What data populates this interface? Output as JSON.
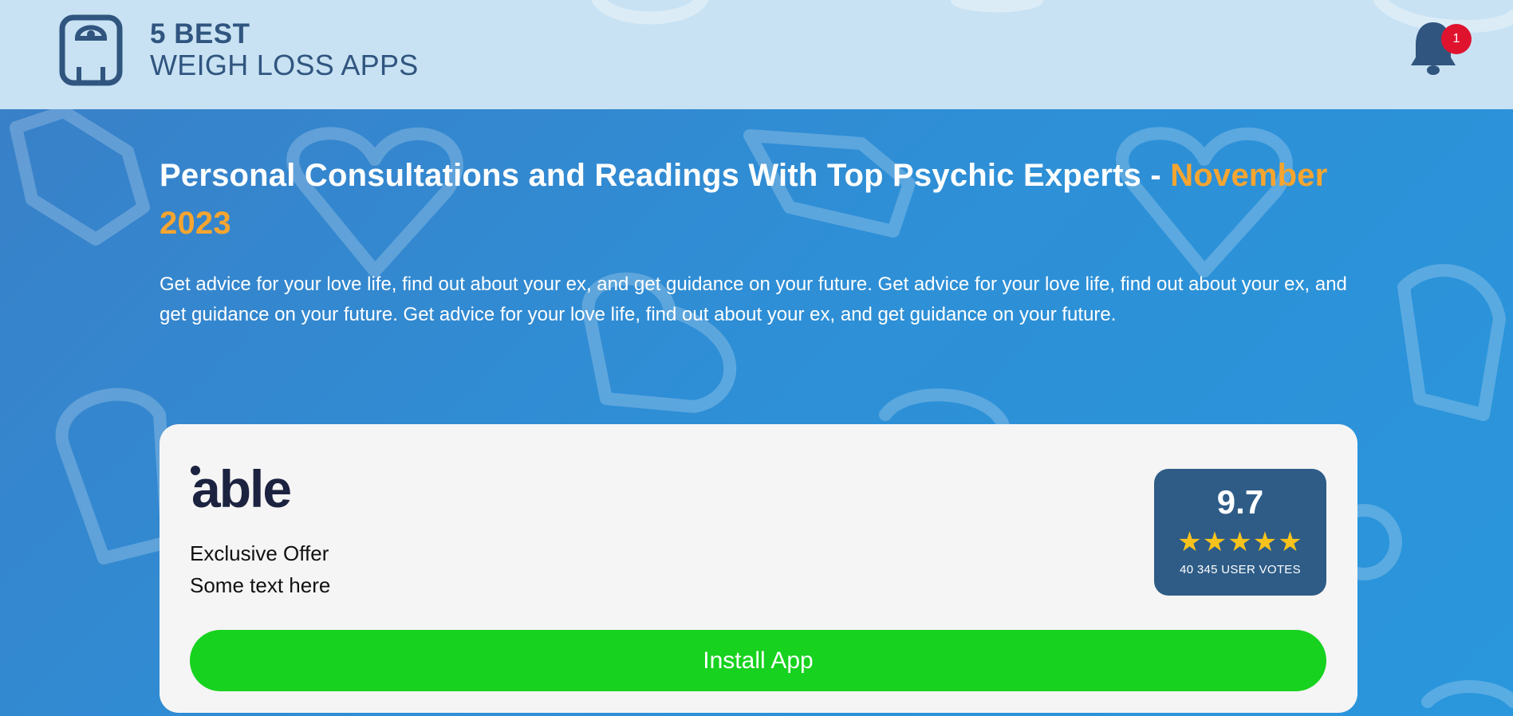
{
  "header": {
    "logo_line1": "5 BEST",
    "logo_line2": "WEIGH LOSS APPS",
    "notification_count": "1"
  },
  "hero": {
    "headline_main": "Personal Consultations and Readings With Top Psychic Experts - ",
    "headline_accent": "November 2023",
    "description": "Get advice for your love life, find out about your ex, and get guidance on your future. Get advice for your love life, find out about your ex, and get guidance on your future. Get advice for your love life, find out about your ex, and get guidance on your future."
  },
  "card": {
    "brand_name": "able",
    "offer_title": "Exclusive Offer",
    "offer_text": "Some text here",
    "rating_score": "9.7",
    "stars": "★★★★★",
    "rating_value": 5,
    "votes": "40 345 USER VOTES",
    "install_label": "Install App"
  },
  "colors": {
    "header_bg": "#c8e2f3",
    "accent": "#f6a530",
    "install_button": "#17d21f",
    "rating_bg": "#2e5c87",
    "badge": "#e0132f"
  },
  "icons": [
    "scale-icon",
    "bell-icon",
    "able-logo",
    "star-icon"
  ]
}
